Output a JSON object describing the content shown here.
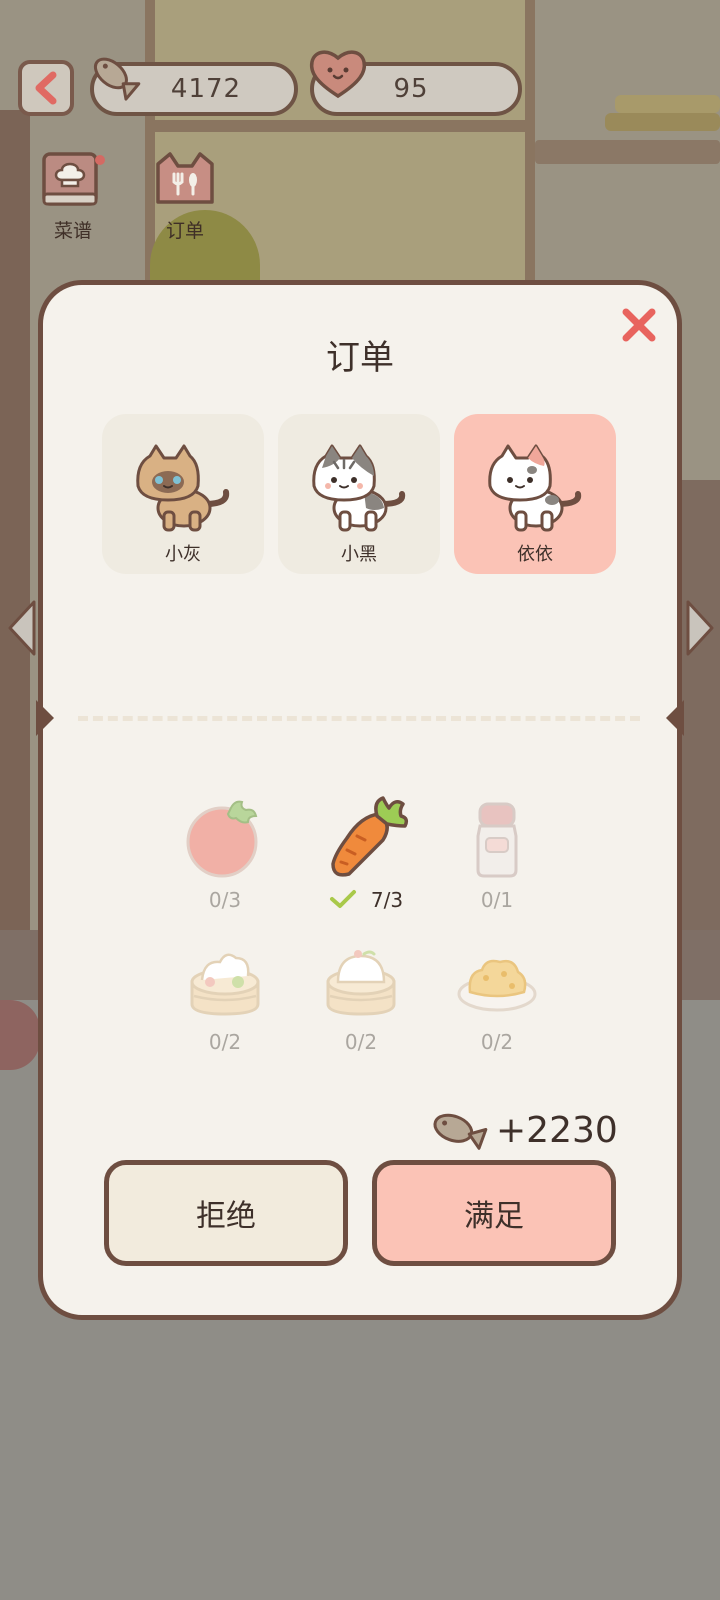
{
  "hud": {
    "fish_count": "4172",
    "heart_count": "95"
  },
  "menu": {
    "recipe_label": "菜谱",
    "order_label": "订单"
  },
  "order_panel": {
    "title": "订单",
    "cats": [
      {
        "name": "小灰",
        "selected": false
      },
      {
        "name": "小黑",
        "selected": false
      },
      {
        "name": "依依",
        "selected": true
      }
    ],
    "items": [
      {
        "icon": "tomato-icon",
        "count": "0/3",
        "done": false
      },
      {
        "icon": "carrot-icon",
        "count": "7/3",
        "done": true
      },
      {
        "icon": "milk-bottle-icon",
        "count": "0/1",
        "done": false
      },
      {
        "icon": "dumpling-steamer-icon",
        "count": "0/2",
        "done": false
      },
      {
        "icon": "bun-steamer-icon",
        "count": "0/2",
        "done": false
      },
      {
        "icon": "fried-rice-plate-icon",
        "count": "0/2",
        "done": false
      }
    ],
    "reward": "+2230",
    "reject_label": "拒绝",
    "accept_label": "满足"
  },
  "colors": {
    "outline": "#6e4e41",
    "panel_bg": "#f5f2ec",
    "accent_pink": "#fbc3b6",
    "close_red": "#e8645e",
    "check_green": "#a9c94a"
  }
}
